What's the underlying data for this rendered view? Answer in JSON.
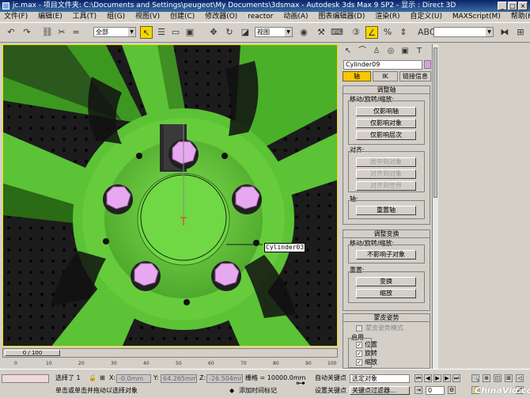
{
  "window": {
    "title": "jc.max  - 项目文件夹: C:\\Documents and Settings\\peugeot\\My Documents\\3dsmax   - Autodesk 3ds Max 9 SP2   - 显示 : Direct 3D",
    "min": "_",
    "max": "□",
    "close": "×"
  },
  "menu": [
    "文件(F)",
    "编辑(E)",
    "工具(T)",
    "组(G)",
    "视图(V)",
    "创建(C)",
    "修改器(O)",
    "reactor",
    "动画(A)",
    "图表编辑器(D)",
    "渲染(R)",
    "自定义(U)",
    "MAXScript(M)",
    "帮助(H)"
  ],
  "toolbar": {
    "selection_filter": "全部",
    "refcoord": "视图",
    "named_selection": ""
  },
  "viewport": {
    "object_label": "Cylinder03"
  },
  "command_panel": {
    "object_name": "Cylinder09",
    "subtabs": [
      "轴",
      "IK",
      "链接信息"
    ],
    "adjust_pivot": {
      "title": "调整轴",
      "move_group": "移动/旋转/缩放:",
      "btn_affect_pivot": "仅影响轴",
      "btn_affect_object": "仅影响对象",
      "btn_affect_hierarchy": "仅影响层次",
      "align_group": "对齐:",
      "btn_center": "居中到对象",
      "btn_align_object": "对齐到对象",
      "btn_align_world": "对齐到世界",
      "pivot_group": "轴:",
      "btn_reset_pivot": "重置轴"
    },
    "adjust_transform": {
      "title": "调整变换",
      "move_group": "移动/旋转/缩放:",
      "btn_dont_affect_children": "不影响子对象",
      "reset_group": "重置:",
      "btn_transform": "变换",
      "btn_scale": "缩放"
    },
    "skin_pose": {
      "title": "蒙皮姿势",
      "chk_skin_pose_mode": "蒙皮姿势模式",
      "enable_group": "启用",
      "chk_position": "位置",
      "chk_rotation": "旋转",
      "chk_scale": "缩放"
    }
  },
  "timeline": {
    "frame": "0 / 100",
    "ticks": [
      "0",
      "10",
      "20",
      "30",
      "40",
      "50",
      "60",
      "70",
      "80",
      "90",
      "100"
    ]
  },
  "status": {
    "selected": "选择了 1",
    "x_label": "X:",
    "x_value": "-0.0mm",
    "y_label": "Y:",
    "y_value": "64.265mm",
    "z_label": "Z:",
    "z_value": "-26.504mm",
    "grid": "栅格 = 10000.0mm",
    "prompt": "单击或单击并拖动以选择对象",
    "add_time_tag": "添加时间标记",
    "auto_key": "自动关键点",
    "set_key": "设置关键点",
    "key_select": "选定对象",
    "key_filters": "关键点过滤器...",
    "frame_field": "0"
  },
  "watermark": "ChinaVid.com"
}
